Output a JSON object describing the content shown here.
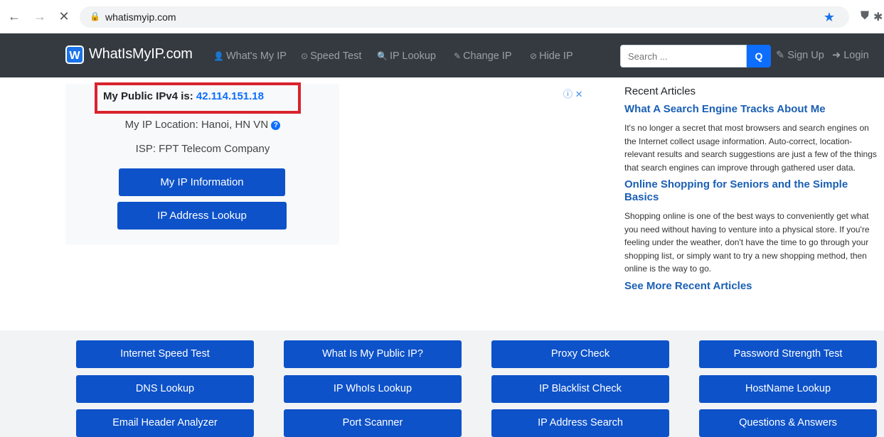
{
  "browser": {
    "back_icon": "←",
    "forward_icon": "→",
    "stop_icon": "✕",
    "lock_icon": "🔒",
    "url": "whatismyip.com",
    "star_icon": "★",
    "shield_icon": "⛊",
    "puzzle_icon": "✱"
  },
  "header": {
    "logo_letter": "W",
    "logo_text": "WhatIsMyIP.com",
    "nav": [
      {
        "icon": "👤",
        "label": "What's My IP"
      },
      {
        "icon": "⊙",
        "label": "Speed Test"
      },
      {
        "icon": "🔍",
        "label": "IP Lookup"
      },
      {
        "icon": "✎",
        "label": "Change IP"
      },
      {
        "icon": "⊘",
        "label": "Hide IP"
      }
    ],
    "search_placeholder": "Search ...",
    "search_icon": "Q",
    "signup_icon": "✎",
    "signup_label": "Sign Up",
    "login_icon": "➜",
    "login_label": "Login"
  },
  "ip_panel": {
    "ip_label": "My Public IPv4 is: ",
    "ip_value": "42.114.151.18",
    "location": "My IP Location: Hanoi, HN VN",
    "help_icon": "?",
    "isp": "ISP: FPT Telecom Company",
    "btn_info": "My IP Information",
    "btn_lookup": "IP Address Lookup"
  },
  "ad": {
    "marker": "ⓘ ✕"
  },
  "articles": {
    "title": "Recent Articles",
    "items": [
      {
        "heading": "What A Search Engine Tracks About Me",
        "body": "It's no longer a secret that most browsers and search engines on the Internet collect usage information. Auto-correct, location-relevant results and search suggestions are just a few of the things that search engines can improve through gathered user data."
      },
      {
        "heading": "Online Shopping for Seniors and the Simple Basics",
        "body": "Shopping online is one of the best ways to conveniently get what you need without having to venture into a physical store. If you're feeling under the weather, don't have the time to go through your shopping list, or simply want to try a new shopping method, then online is the way to go."
      }
    ],
    "see_more": "See More Recent Articles"
  },
  "tools": [
    "Internet Speed Test",
    "What Is My Public IP?",
    "Proxy Check",
    "Password Strength Test",
    "DNS Lookup",
    "IP WhoIs Lookup",
    "IP Blacklist Check",
    "HostName Lookup",
    "Email Header Analyzer",
    "Port Scanner",
    "IP Address Search",
    "Questions & Answers"
  ]
}
